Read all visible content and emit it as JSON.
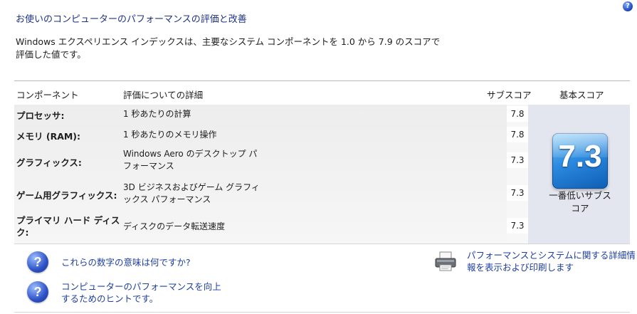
{
  "title": "お使いのコンピューターのパフォーマンスの評価と改善",
  "help_icon": "?",
  "intro": [
    "Windows エクスペリエンス インデックスは、主要なシステム コンポーネントを 1.0 から 7.9 のスコアで",
    "評価した値です。"
  ],
  "table": {
    "headers": {
      "component": "コンポーネント",
      "details": "評価についての詳細",
      "subscore": "サブスコア",
      "basescore": "基本スコア"
    },
    "rows": [
      {
        "name": "プロセッサ:",
        "desc": [
          "1 秒あたりの計算"
        ],
        "score": "7.8"
      },
      {
        "name": "メモリ (RAM):",
        "desc": [
          "1 秒あたりのメモリ操作"
        ],
        "score": "7.8"
      },
      {
        "name": "グラフィックス:",
        "desc": [
          "Windows Aero のデスクトップ パ",
          "フォーマンス"
        ],
        "score": "7.3"
      },
      {
        "name": "ゲーム用グラフィックス:",
        "desc": [
          "3D ビジネスおよびゲーム グラフィ",
          "ックス パフォーマンス"
        ],
        "score": "7.3"
      },
      {
        "name": [
          "プライマリ ハード ディス",
          "ク:"
        ],
        "desc": [
          "ディスクのデータ転送速度"
        ],
        "score": "7.3"
      }
    ],
    "base": {
      "value": "7.3",
      "label": [
        "一番低いサブス",
        "コア"
      ]
    }
  },
  "links": {
    "meaning": "これらの数字の意味は何ですか?",
    "tips": [
      "コンピューターのパフォーマンスを向上",
      "するためのヒントです。"
    ],
    "print": [
      "パフォーマンスとシステムに関する詳細情",
      "報を表示および印刷します"
    ]
  },
  "icons": {
    "question": "question-icon",
    "printer": "printer-icon"
  }
}
